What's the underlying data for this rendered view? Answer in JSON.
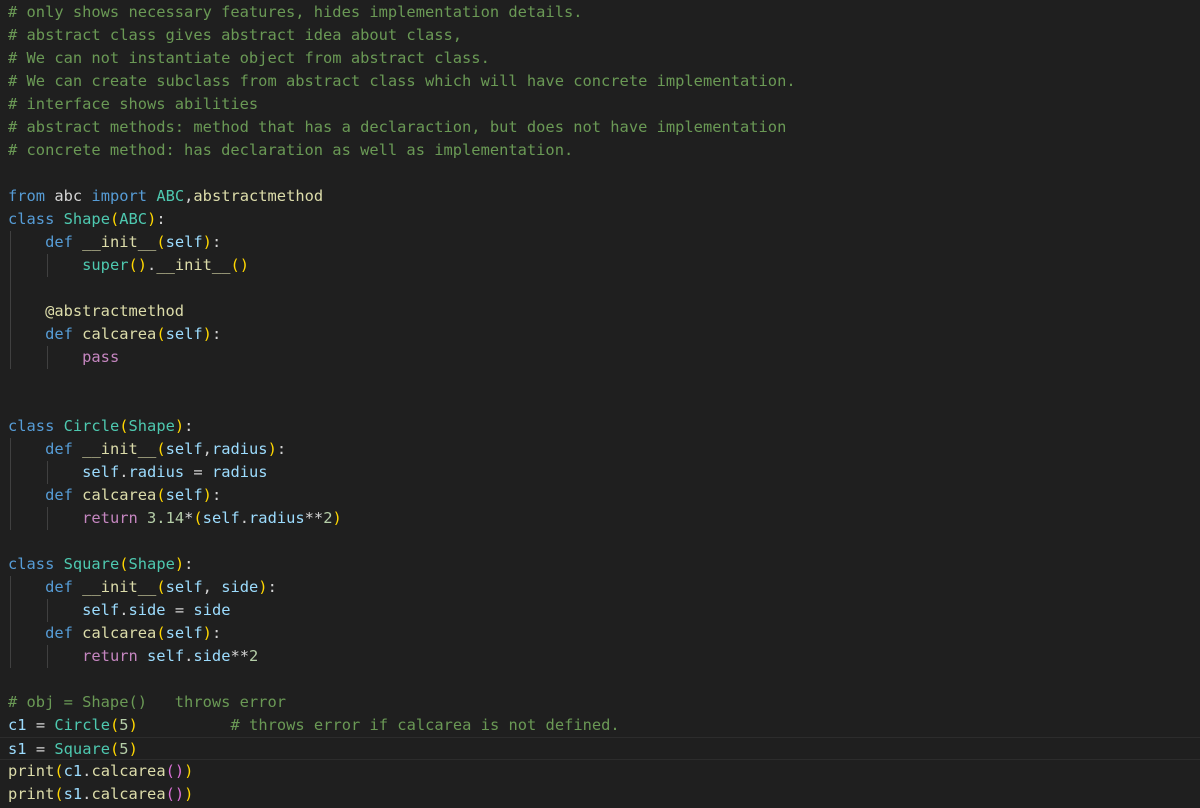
{
  "editor": {
    "background": "#1f1f1f",
    "language": "python",
    "colors": {
      "comment": "#6a9955",
      "keyword": "#569cd6",
      "control": "#c586c0",
      "class": "#4ec9b0",
      "function": "#dcdcaa",
      "parameter": "#9cdcfe",
      "number": "#b5cea8",
      "text": "#d4d4d4",
      "bracket_1": "#ffd700",
      "bracket_2": "#da70d6"
    }
  },
  "lines": [
    {
      "guides": 0,
      "tokens": [
        {
          "t": "comment",
          "v": "# only shows necessary features, hides implementation details."
        }
      ]
    },
    {
      "guides": 0,
      "tokens": [
        {
          "t": "comment",
          "v": "# abstract class gives abstract idea about class,"
        }
      ]
    },
    {
      "guides": 0,
      "tokens": [
        {
          "t": "comment",
          "v": "# We can not instantiate object from abstract class."
        }
      ]
    },
    {
      "guides": 0,
      "tokens": [
        {
          "t": "comment",
          "v": "# We can create subclass from abstract class which will have concrete implementation."
        }
      ]
    },
    {
      "guides": 0,
      "tokens": [
        {
          "t": "comment",
          "v": "# interface shows abilities"
        }
      ]
    },
    {
      "guides": 0,
      "tokens": [
        {
          "t": "comment",
          "v": "# abstract methods: method that has a declaraction, but does not have implementation"
        }
      ]
    },
    {
      "guides": 0,
      "tokens": [
        {
          "t": "comment",
          "v": "# concrete method: has declaration as well as implementation."
        }
      ]
    },
    {
      "guides": 0,
      "tokens": []
    },
    {
      "guides": 0,
      "tokens": [
        {
          "t": "keyword",
          "v": "from"
        },
        {
          "t": "plain",
          "v": " abc "
        },
        {
          "t": "keyword",
          "v": "import"
        },
        {
          "t": "plain",
          "v": " "
        },
        {
          "t": "class",
          "v": "ABC"
        },
        {
          "t": "plain",
          "v": ","
        },
        {
          "t": "func",
          "v": "abstractmethod"
        }
      ]
    },
    {
      "guides": 0,
      "tokens": [
        {
          "t": "keyword",
          "v": "class"
        },
        {
          "t": "plain",
          "v": " "
        },
        {
          "t": "class",
          "v": "Shape"
        },
        {
          "t": "paren1",
          "v": "("
        },
        {
          "t": "class",
          "v": "ABC"
        },
        {
          "t": "paren1",
          "v": ")"
        },
        {
          "t": "plain",
          "v": ":"
        }
      ]
    },
    {
      "guides": 1,
      "tokens": [
        {
          "t": "plain",
          "v": "    "
        },
        {
          "t": "keyword",
          "v": "def"
        },
        {
          "t": "plain",
          "v": " "
        },
        {
          "t": "func",
          "v": "__init__"
        },
        {
          "t": "paren1",
          "v": "("
        },
        {
          "t": "param",
          "v": "self"
        },
        {
          "t": "paren1",
          "v": ")"
        },
        {
          "t": "plain",
          "v": ":"
        }
      ]
    },
    {
      "guides": 2,
      "tokens": [
        {
          "t": "plain",
          "v": "        "
        },
        {
          "t": "class",
          "v": "super"
        },
        {
          "t": "paren1",
          "v": "()"
        },
        {
          "t": "plain",
          "v": "."
        },
        {
          "t": "func",
          "v": "__init__"
        },
        {
          "t": "paren1",
          "v": "()"
        }
      ]
    },
    {
      "guides": 1,
      "tokens": []
    },
    {
      "guides": 1,
      "tokens": [
        {
          "t": "plain",
          "v": "    "
        },
        {
          "t": "deco",
          "v": "@abstractmethod"
        }
      ]
    },
    {
      "guides": 1,
      "tokens": [
        {
          "t": "plain",
          "v": "    "
        },
        {
          "t": "keyword",
          "v": "def"
        },
        {
          "t": "plain",
          "v": " "
        },
        {
          "t": "func",
          "v": "calcarea"
        },
        {
          "t": "paren1",
          "v": "("
        },
        {
          "t": "param",
          "v": "self"
        },
        {
          "t": "paren1",
          "v": ")"
        },
        {
          "t": "plain",
          "v": ":"
        }
      ]
    },
    {
      "guides": 2,
      "tokens": [
        {
          "t": "plain",
          "v": "        "
        },
        {
          "t": "control",
          "v": "pass"
        }
      ]
    },
    {
      "guides": 0,
      "tokens": []
    },
    {
      "guides": 0,
      "tokens": []
    },
    {
      "guides": 0,
      "tokens": [
        {
          "t": "keyword",
          "v": "class"
        },
        {
          "t": "plain",
          "v": " "
        },
        {
          "t": "class",
          "v": "Circle"
        },
        {
          "t": "paren1",
          "v": "("
        },
        {
          "t": "class",
          "v": "Shape"
        },
        {
          "t": "paren1",
          "v": ")"
        },
        {
          "t": "plain",
          "v": ":"
        }
      ]
    },
    {
      "guides": 1,
      "tokens": [
        {
          "t": "plain",
          "v": "    "
        },
        {
          "t": "keyword",
          "v": "def"
        },
        {
          "t": "plain",
          "v": " "
        },
        {
          "t": "func",
          "v": "__init__"
        },
        {
          "t": "paren1",
          "v": "("
        },
        {
          "t": "param",
          "v": "self"
        },
        {
          "t": "plain",
          "v": ","
        },
        {
          "t": "param",
          "v": "radius"
        },
        {
          "t": "paren1",
          "v": ")"
        },
        {
          "t": "plain",
          "v": ":"
        }
      ]
    },
    {
      "guides": 2,
      "tokens": [
        {
          "t": "plain",
          "v": "        "
        },
        {
          "t": "param",
          "v": "self"
        },
        {
          "t": "plain",
          "v": "."
        },
        {
          "t": "param",
          "v": "radius"
        },
        {
          "t": "plain",
          "v": " "
        },
        {
          "t": "op",
          "v": "="
        },
        {
          "t": "plain",
          "v": " "
        },
        {
          "t": "param",
          "v": "radius"
        }
      ]
    },
    {
      "guides": 1,
      "tokens": [
        {
          "t": "plain",
          "v": "    "
        },
        {
          "t": "keyword",
          "v": "def"
        },
        {
          "t": "plain",
          "v": " "
        },
        {
          "t": "func",
          "v": "calcarea"
        },
        {
          "t": "paren1",
          "v": "("
        },
        {
          "t": "param",
          "v": "self"
        },
        {
          "t": "paren1",
          "v": ")"
        },
        {
          "t": "plain",
          "v": ":"
        }
      ]
    },
    {
      "guides": 2,
      "tokens": [
        {
          "t": "plain",
          "v": "        "
        },
        {
          "t": "control",
          "v": "return"
        },
        {
          "t": "plain",
          "v": " "
        },
        {
          "t": "number",
          "v": "3.14"
        },
        {
          "t": "op",
          "v": "*"
        },
        {
          "t": "paren1",
          "v": "("
        },
        {
          "t": "param",
          "v": "self"
        },
        {
          "t": "plain",
          "v": "."
        },
        {
          "t": "param",
          "v": "radius"
        },
        {
          "t": "op",
          "v": "**"
        },
        {
          "t": "number",
          "v": "2"
        },
        {
          "t": "paren1",
          "v": ")"
        }
      ]
    },
    {
      "guides": 0,
      "tokens": []
    },
    {
      "guides": 0,
      "tokens": [
        {
          "t": "keyword",
          "v": "class"
        },
        {
          "t": "plain",
          "v": " "
        },
        {
          "t": "class",
          "v": "Square"
        },
        {
          "t": "paren1",
          "v": "("
        },
        {
          "t": "class",
          "v": "Shape"
        },
        {
          "t": "paren1",
          "v": ")"
        },
        {
          "t": "plain",
          "v": ":"
        }
      ]
    },
    {
      "guides": 1,
      "tokens": [
        {
          "t": "plain",
          "v": "    "
        },
        {
          "t": "keyword",
          "v": "def"
        },
        {
          "t": "plain",
          "v": " "
        },
        {
          "t": "func",
          "v": "__init__"
        },
        {
          "t": "paren1",
          "v": "("
        },
        {
          "t": "param",
          "v": "self"
        },
        {
          "t": "plain",
          "v": ", "
        },
        {
          "t": "param",
          "v": "side"
        },
        {
          "t": "paren1",
          "v": ")"
        },
        {
          "t": "plain",
          "v": ":"
        }
      ]
    },
    {
      "guides": 2,
      "tokens": [
        {
          "t": "plain",
          "v": "        "
        },
        {
          "t": "param",
          "v": "self"
        },
        {
          "t": "plain",
          "v": "."
        },
        {
          "t": "param",
          "v": "side"
        },
        {
          "t": "plain",
          "v": " "
        },
        {
          "t": "op",
          "v": "="
        },
        {
          "t": "plain",
          "v": " "
        },
        {
          "t": "param",
          "v": "side"
        }
      ]
    },
    {
      "guides": 1,
      "tokens": [
        {
          "t": "plain",
          "v": "    "
        },
        {
          "t": "keyword",
          "v": "def"
        },
        {
          "t": "plain",
          "v": " "
        },
        {
          "t": "func",
          "v": "calcarea"
        },
        {
          "t": "paren1",
          "v": "("
        },
        {
          "t": "param",
          "v": "self"
        },
        {
          "t": "paren1",
          "v": ")"
        },
        {
          "t": "plain",
          "v": ":"
        }
      ]
    },
    {
      "guides": 2,
      "tokens": [
        {
          "t": "plain",
          "v": "        "
        },
        {
          "t": "control",
          "v": "return"
        },
        {
          "t": "plain",
          "v": " "
        },
        {
          "t": "param",
          "v": "self"
        },
        {
          "t": "plain",
          "v": "."
        },
        {
          "t": "param",
          "v": "side"
        },
        {
          "t": "op",
          "v": "**"
        },
        {
          "t": "number",
          "v": "2"
        }
      ]
    },
    {
      "guides": 0,
      "tokens": []
    },
    {
      "guides": 0,
      "tokens": [
        {
          "t": "comment",
          "v": "# obj = Shape()   throws error"
        }
      ]
    },
    {
      "guides": 0,
      "tokens": [
        {
          "t": "param",
          "v": "c1"
        },
        {
          "t": "plain",
          "v": " "
        },
        {
          "t": "op",
          "v": "="
        },
        {
          "t": "plain",
          "v": " "
        },
        {
          "t": "class",
          "v": "Circle"
        },
        {
          "t": "paren1",
          "v": "("
        },
        {
          "t": "number",
          "v": "5"
        },
        {
          "t": "paren1",
          "v": ")"
        },
        {
          "t": "plain",
          "v": "          "
        },
        {
          "t": "comment",
          "v": "# throws error if calcarea is not defined."
        }
      ]
    },
    {
      "guides": 0,
      "tokens": [
        {
          "t": "param",
          "v": "s1"
        },
        {
          "t": "plain",
          "v": " "
        },
        {
          "t": "op",
          "v": "="
        },
        {
          "t": "plain",
          "v": " "
        },
        {
          "t": "class",
          "v": "Square"
        },
        {
          "t": "paren1",
          "v": "("
        },
        {
          "t": "number",
          "v": "5"
        },
        {
          "t": "paren1",
          "v": ")"
        }
      ],
      "current": true
    },
    {
      "guides": 0,
      "tokens": [
        {
          "t": "func",
          "v": "print"
        },
        {
          "t": "paren1",
          "v": "("
        },
        {
          "t": "param",
          "v": "c1"
        },
        {
          "t": "plain",
          "v": "."
        },
        {
          "t": "func",
          "v": "calcarea"
        },
        {
          "t": "paren2",
          "v": "()"
        },
        {
          "t": "paren1",
          "v": ")"
        }
      ]
    },
    {
      "guides": 0,
      "tokens": [
        {
          "t": "func",
          "v": "print"
        },
        {
          "t": "paren1",
          "v": "("
        },
        {
          "t": "param",
          "v": "s1"
        },
        {
          "t": "plain",
          "v": "."
        },
        {
          "t": "func",
          "v": "calcarea"
        },
        {
          "t": "paren2",
          "v": "()"
        },
        {
          "t": "paren1",
          "v": ")"
        }
      ]
    }
  ]
}
